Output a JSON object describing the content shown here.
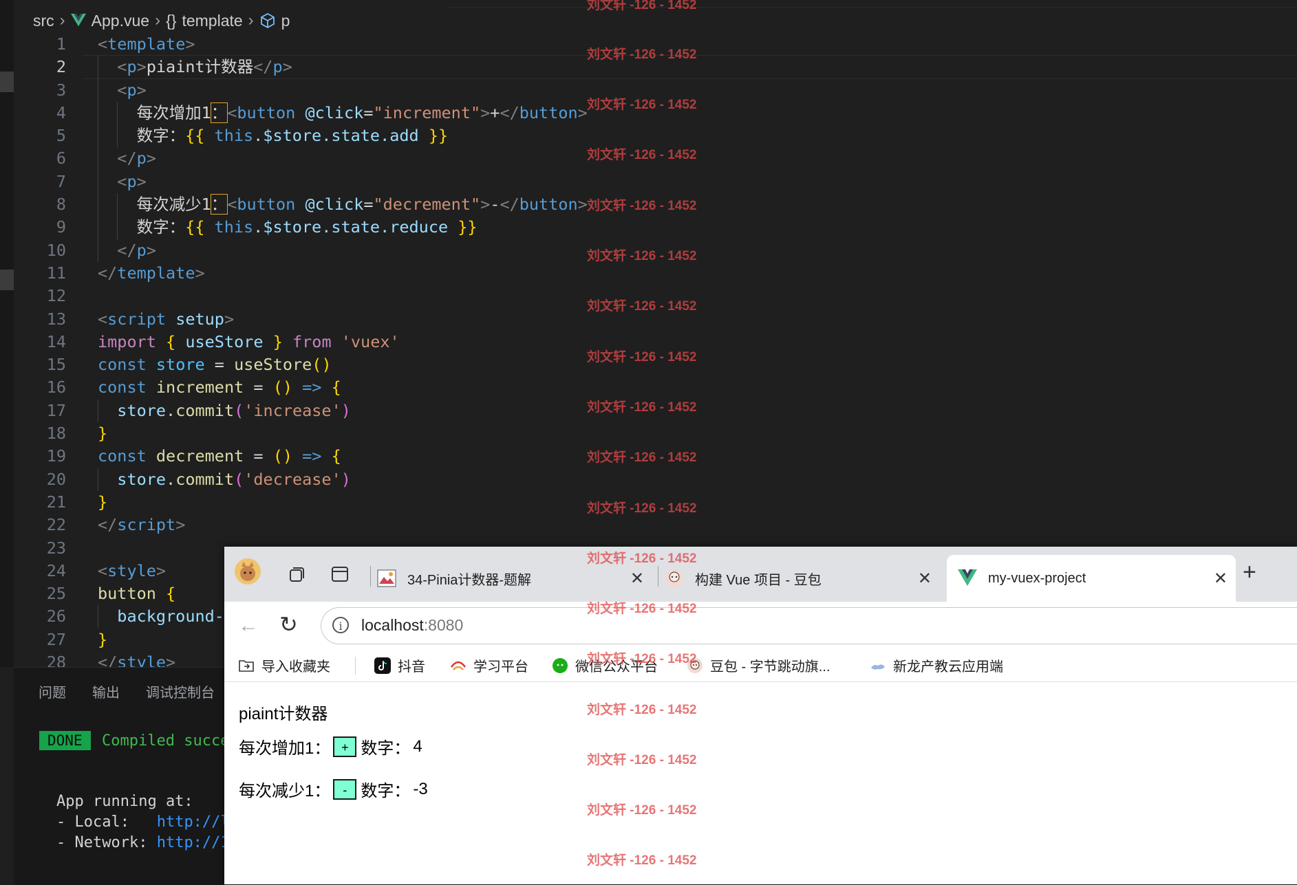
{
  "breadcrumb": {
    "src": "src",
    "file": "App.vue",
    "template": "template",
    "node": "p"
  },
  "code_lines": [
    "1",
    "2",
    "3",
    "4",
    "5",
    "6",
    "7",
    "8",
    "9",
    "10",
    "11",
    "12",
    "13",
    "14",
    "15",
    "16",
    "17",
    "18",
    "19",
    "20",
    "21",
    "22",
    "23",
    "24",
    "25",
    "26",
    "27",
    "28"
  ],
  "code": {
    "l1": "template",
    "l2_text": "piaint计数器",
    "l4_text": "每次增加1",
    "l4_colon": "：",
    "l4_attr": "@click",
    "l4_val": "\"increment\"",
    "l4_plus": "+",
    "l5_label": "数字：",
    "l5_expr": "$store",
    "l5_tail": ".state.add",
    "l8_text": "每次减少1",
    "l8_val": "\"decrement\"",
    "l8_minus": "-",
    "l9_tail": ".state.reduce",
    "l13_tag": "script",
    "l13_attr": "setup",
    "l14_import": "import",
    "l14_name": "useStore",
    "l14_from": "from",
    "l14_str": "'vuex'",
    "l15_const": "const",
    "l15_var": "store",
    "l15_fn": "useStore",
    "l16_fn": "increment",
    "l17_call": "commit",
    "l17_str": "'increase'",
    "l19_fn": "decrement",
    "l20_str": "'decrease'",
    "l22_tag": "script",
    "l24_tag": "style",
    "l25_sel": "button",
    "l26_prop": "background-c",
    "l28_tag": "style"
  },
  "panel": {
    "tabs": [
      "问题",
      "输出",
      "调试控制台"
    ],
    "done": "DONE",
    "compiled": "Compiled succe",
    "app_running": "App running at:",
    "local_label": "- Local:   ",
    "local_url": "http://l",
    "network_label": "- Network: ",
    "network_url": "http://1"
  },
  "browser": {
    "tabs": [
      {
        "title": "34-Pinia计数器-题解"
      },
      {
        "title": "构建 Vue 项目 - 豆包"
      },
      {
        "title": "my-vuex-project"
      }
    ],
    "url_host": "localhost",
    "url_port": ":8080",
    "bookmarks": [
      "导入收藏夹",
      "抖音",
      "学习平台",
      "微信公众平台",
      "豆包 - 字节跳动旗...",
      "新龙产教云应用端"
    ],
    "page": {
      "title": "piaint计数器",
      "inc_label": "每次增加1：",
      "inc_btn": "+",
      "inc_value_label": "数字：",
      "inc_value": "4",
      "dec_label": "每次减少1：",
      "dec_btn": "-",
      "dec_value_label": "数字：",
      "dec_value": "-3"
    }
  },
  "watermark": "刘文轩 -126 - 1452"
}
